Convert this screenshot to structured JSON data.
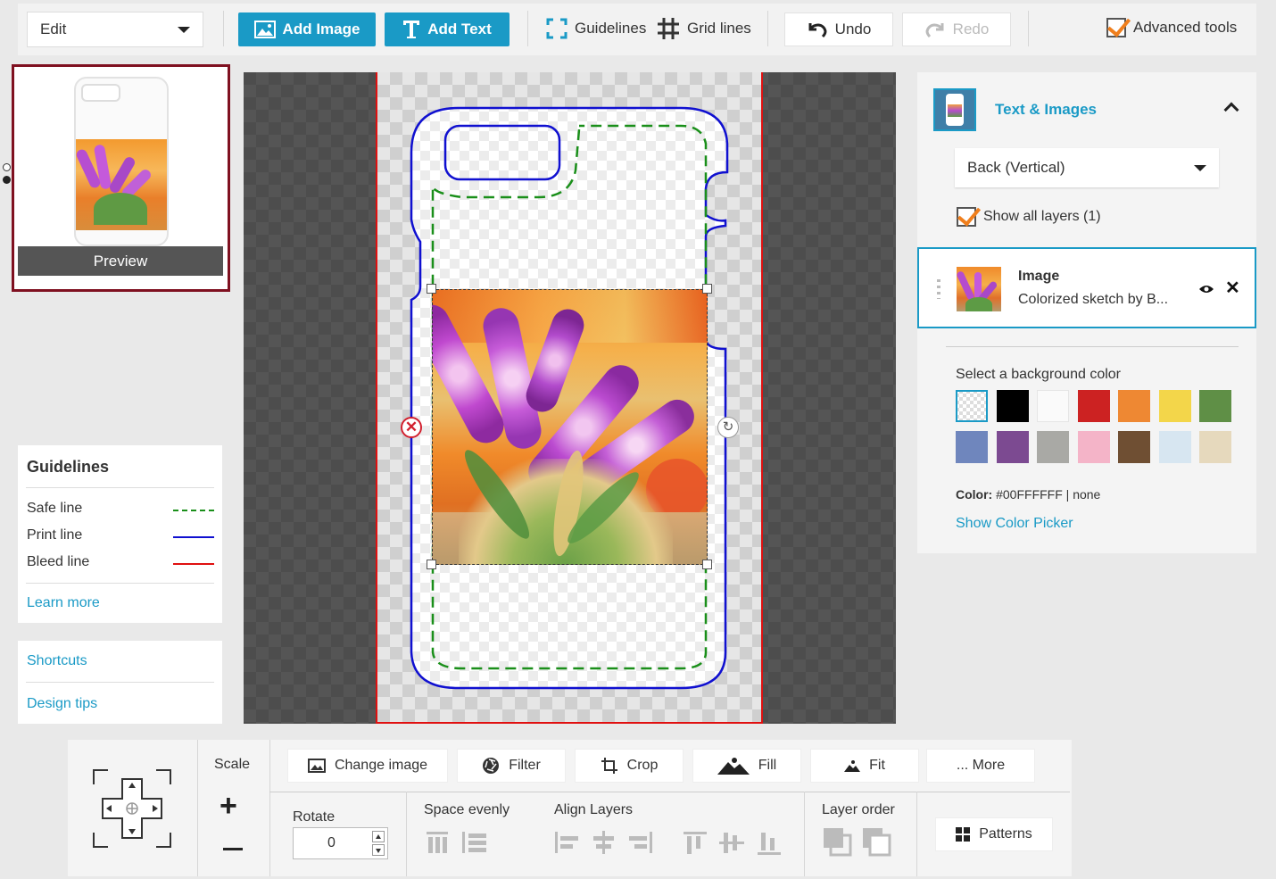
{
  "toolbar": {
    "mode_value": "Edit",
    "add_image_label": "Add Image",
    "add_text_label": "Add Text",
    "guidelines_label": "Guidelines",
    "grid_lines_label": "Grid lines",
    "undo_label": "Undo",
    "redo_label": "Redo",
    "advanced_tools_label": "Advanced tools",
    "advanced_tools_checked": true
  },
  "preview": {
    "label": "Preview"
  },
  "guidelines_panel": {
    "title": "Guidelines",
    "items": [
      {
        "label": "Safe line",
        "color": "#1a8f1a",
        "style": "dashed"
      },
      {
        "label": "Print line",
        "color": "#1010d0",
        "style": "solid"
      },
      {
        "label": "Bleed line",
        "color": "#e01010",
        "style": "solid"
      }
    ],
    "learn_more": "Learn more"
  },
  "help_links": {
    "shortcuts": "Shortcuts",
    "design_tips": "Design tips"
  },
  "right_panel": {
    "section_title": "Text & Images",
    "side_select_value": "Back (Vertical)",
    "show_all_layers_label": "Show all layers (1)",
    "show_all_layers_checked": true,
    "layer": {
      "type": "Image",
      "name": "Colorized sketch by B..."
    },
    "background": {
      "label": "Select a background color",
      "swatches": [
        "transparent",
        "#000000",
        "#fafafa",
        "#cc2222",
        "#ee8833",
        "#f3d64a",
        "#5f8f46",
        "#6f86bd",
        "#7c4a91",
        "#a9a9a5",
        "#f4b4c8",
        "#6f4f33",
        "#d7e6f1",
        "#e6d9bd"
      ],
      "color_label": "Color:",
      "color_value": "#00FFFFFF | none",
      "show_picker": "Show Color Picker"
    }
  },
  "bottom": {
    "scale_label": "Scale",
    "rotate_label": "Rotate",
    "rotate_value": "0",
    "change_image": "Change image",
    "filter": "Filter",
    "crop": "Crop",
    "fill": "Fill",
    "fit": "Fit",
    "more": "... More",
    "space_evenly": "Space evenly",
    "align_layers": "Align Layers",
    "layer_order": "Layer order",
    "patterns": "Patterns"
  },
  "colors": {
    "accent": "#1a9ac6",
    "preview_border": "#7f1020",
    "selection_border": "#1a9ac6",
    "checkbox_tick": "#f07f1d"
  }
}
